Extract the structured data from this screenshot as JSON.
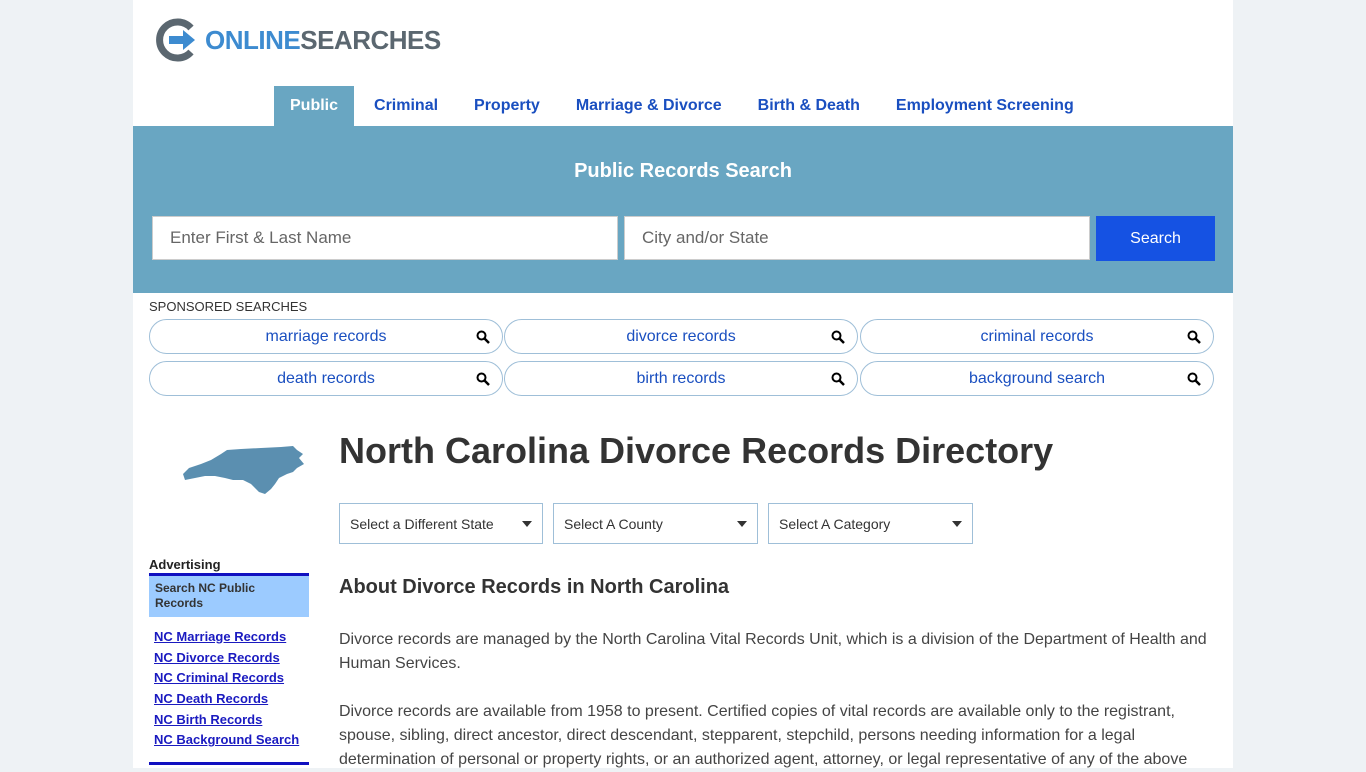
{
  "header": {
    "logo_part1": "ONLINE",
    "logo_part2": "SEARCHES"
  },
  "nav": {
    "items": [
      {
        "label": "Public",
        "active": true
      },
      {
        "label": "Criminal"
      },
      {
        "label": "Property"
      },
      {
        "label": "Marriage & Divorce"
      },
      {
        "label": "Birth & Death"
      },
      {
        "label": "Employment Screening"
      }
    ]
  },
  "search": {
    "title": "Public Records Search",
    "name_placeholder": "Enter First & Last Name",
    "location_placeholder": "City and/or State",
    "button_label": "Search"
  },
  "sponsored": {
    "label": "SPONSORED SEARCHES",
    "items": [
      "marriage records",
      "divorce records",
      "criminal records",
      "death records",
      "birth records",
      "background search"
    ]
  },
  "sidebar": {
    "map_icon": "north-carolina-map-icon",
    "advertising_label": "Advertising",
    "ad_box_title": "Search NC Public Records",
    "links": [
      "NC Marriage Records",
      "NC Divorce Records",
      "NC Criminal Records",
      "NC Death Records",
      "NC Birth Records",
      "NC Background Search"
    ]
  },
  "main": {
    "title": "North Carolina Divorce Records Directory",
    "selects": [
      "Select a Different State",
      "Select A County",
      "Select A Category"
    ],
    "section_title": "About Divorce Records in North Carolina",
    "paragraph1": "Divorce records are managed by the North Carolina Vital Records Unit, which is a division of the Department of Health and Human Services.",
    "paragraph2": "Divorce records are available from 1958 to present. Certified copies of vital records are available only to the registrant, spouse, sibling, direct ancestor, direct descendant, stepparent, stepchild, persons needing information for a legal determination of personal or property rights, or an authorized agent, attorney, or legal representative of any of the above"
  },
  "colors": {
    "accent": "#69a6c2",
    "link": "#1a4fc0",
    "button": "#1552e3"
  }
}
